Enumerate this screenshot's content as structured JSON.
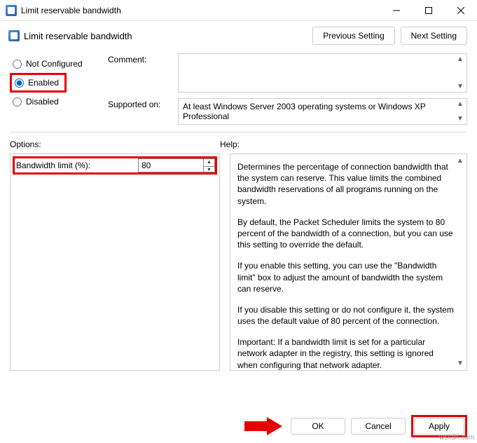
{
  "window": {
    "title": "Limit reservable bandwidth"
  },
  "header": {
    "title": "Limit reservable bandwidth",
    "prev": "Previous Setting",
    "next": "Next Setting"
  },
  "radios": {
    "not_configured": "Not Configured",
    "enabled": "Enabled",
    "disabled": "Disabled",
    "selected": "enabled"
  },
  "labels": {
    "comment": "Comment:",
    "supported": "Supported on:",
    "options": "Options:",
    "help": "Help:"
  },
  "supported_text": "At least Windows Server 2003 operating systems or Windows XP Professional",
  "comment_text": "",
  "options": {
    "bandwidth_label": "Bandwidth limit (%):",
    "bandwidth_value": "80"
  },
  "help_text": {
    "p1": "Determines the percentage of connection bandwidth that the system can reserve. This value limits the combined bandwidth reservations of all programs running on the system.",
    "p2": "By default, the Packet Scheduler limits the system to 80 percent of the bandwidth of a connection, but you can use this setting to override the default.",
    "p3": "If you enable this setting, you can use the \"Bandwidth limit\" box to adjust the amount of bandwidth the system can reserve.",
    "p4": "If you disable this setting or do not configure it, the system uses the default value of 80 percent of the connection.",
    "p5": "Important: If a bandwidth limit is set for a particular network adapter in the registry, this setting is ignored when configuring that network adapter."
  },
  "footer": {
    "ok": "OK",
    "cancel": "Cancel",
    "apply": "Apply"
  },
  "watermark": "wsxdn.com"
}
